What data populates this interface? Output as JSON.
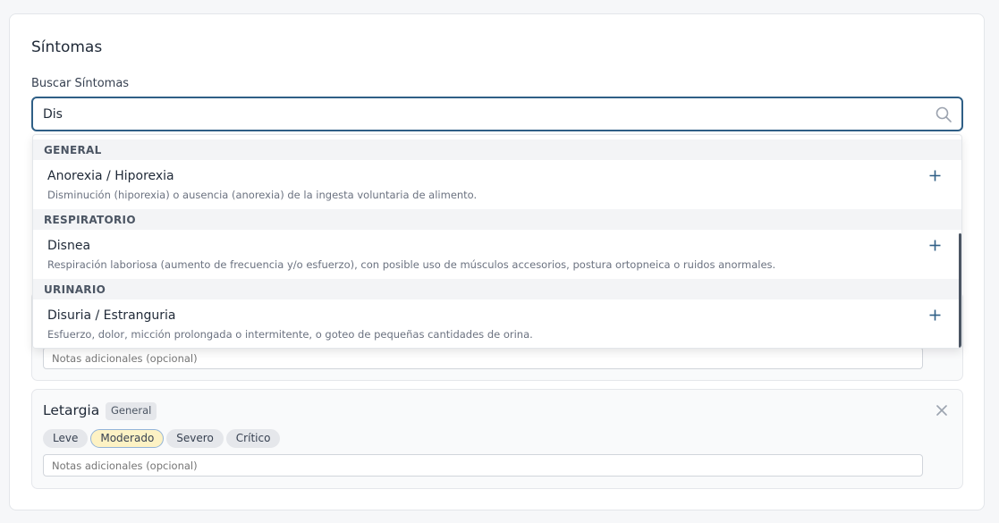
{
  "section": {
    "title": "Síntomas",
    "search_label": "Buscar Síntomas",
    "search_value": "Dis"
  },
  "dropdown": {
    "groups": [
      {
        "header": "GENERAL",
        "options": [
          {
            "name": "Anorexia / Hiporexia",
            "description": "Disminución (hiporexia) o ausencia (anorexia) de la ingesta voluntaria de alimento."
          }
        ]
      },
      {
        "header": "RESPIRATORIO",
        "options": [
          {
            "name": "Disnea",
            "description": "Respiración laboriosa (aumento de frecuencia y/o esfuerzo), con posible uso de músculos accesorios, postura ortopneica o ruidos anormales."
          }
        ]
      },
      {
        "header": "URINARIO",
        "options": [
          {
            "name": "Disuria / Estranguria",
            "description": "Esfuerzo, dolor, micción prolongada o intermitente, o goteo de pequeñas cantidades de orina."
          }
        ]
      }
    ]
  },
  "selected_symptoms": [
    {
      "notes_placeholder": "Notas adicionales (opcional)"
    },
    {
      "name": "Letargia",
      "category": "General",
      "severities": [
        "Leve",
        "Moderado",
        "Severo",
        "Crítico"
      ],
      "selected_severity": "Moderado",
      "notes_placeholder": "Notas adicionales (opcional)"
    }
  ],
  "icons": {
    "search": "search-icon",
    "add": "plus-icon",
    "remove": "close-icon"
  },
  "colors": {
    "accent": "#2f5f86",
    "selected_severity_bg": "#fdf2c4",
    "selected_severity_border": "#93b4d8"
  }
}
